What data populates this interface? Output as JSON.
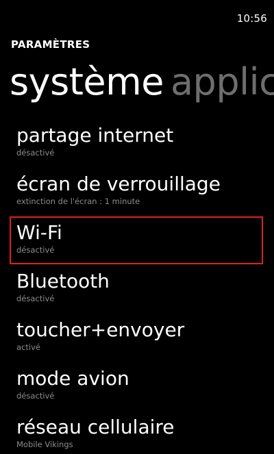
{
  "status_bar": {
    "time": "10:56"
  },
  "header": {
    "app_title": "PARAMÈTRES"
  },
  "pivot": {
    "active_label": "système",
    "next_label": "applic"
  },
  "settings": [
    {
      "title": "partage internet",
      "subtitle": "désactivé"
    },
    {
      "title": "écran de verrouillage",
      "subtitle": "extinction de l'écran : 1 minute"
    },
    {
      "title": "Wi-Fi",
      "subtitle": "désactivé"
    },
    {
      "title": "Bluetooth",
      "subtitle": "désactivé"
    },
    {
      "title": "toucher+envoyer",
      "subtitle": "activé"
    },
    {
      "title": "mode avion",
      "subtitle": "désactivé"
    },
    {
      "title": "réseau cellulaire",
      "subtitle": "Mobile Vikings"
    }
  ],
  "colors": {
    "background": "#000000",
    "text": "#ffffff",
    "subtext": "#8c8c8c",
    "inactive_pivot": "#6e6e6e",
    "highlight": "#e0201c"
  }
}
